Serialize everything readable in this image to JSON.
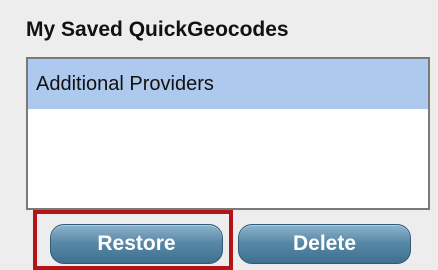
{
  "panel": {
    "title": "My Saved QuickGeocodes"
  },
  "list": {
    "items": [
      {
        "label": "Additional Providers",
        "selected": true
      }
    ]
  },
  "buttons": {
    "restore_label": "Restore",
    "delete_label": "Delete"
  },
  "colors": {
    "selection": "#adc9ee",
    "button": "#5a89a8",
    "highlight": "#b51318"
  }
}
